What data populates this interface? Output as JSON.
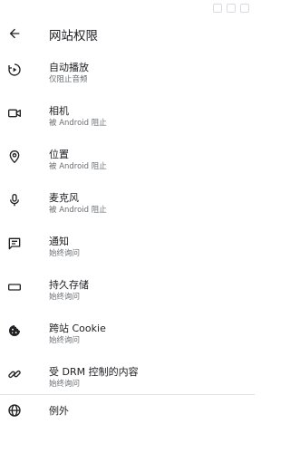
{
  "header": {
    "title": "网站权限",
    "back_icon": "arrow-back-icon"
  },
  "settings": [
    {
      "label": "自动播放",
      "sub": "仅阻止音频",
      "icon": "autoplay-icon"
    },
    {
      "label": "相机",
      "sub": "被 Android 阻止",
      "icon": "camera-icon"
    },
    {
      "label": "位置",
      "sub": "被 Android 阻止",
      "icon": "location-icon"
    },
    {
      "label": "麦克风",
      "sub": "被 Android 阻止",
      "icon": "microphone-icon"
    },
    {
      "label": "通知",
      "sub": "始终询问",
      "icon": "notification-icon"
    },
    {
      "label": "持久存储",
      "sub": "始终询问",
      "icon": "storage-icon"
    },
    {
      "label": "跨站 Cookie",
      "sub": "始终询问",
      "icon": "cookie-icon"
    },
    {
      "label": "受 DRM 控制的内容",
      "sub": "始终询问",
      "icon": "drm-link-icon"
    }
  ],
  "exceptions": {
    "label": "例外",
    "icon": "globe-icon"
  },
  "colors": {
    "text": "#202124",
    "secondary": "#6a6d72",
    "divider": "#e3e3e3"
  }
}
